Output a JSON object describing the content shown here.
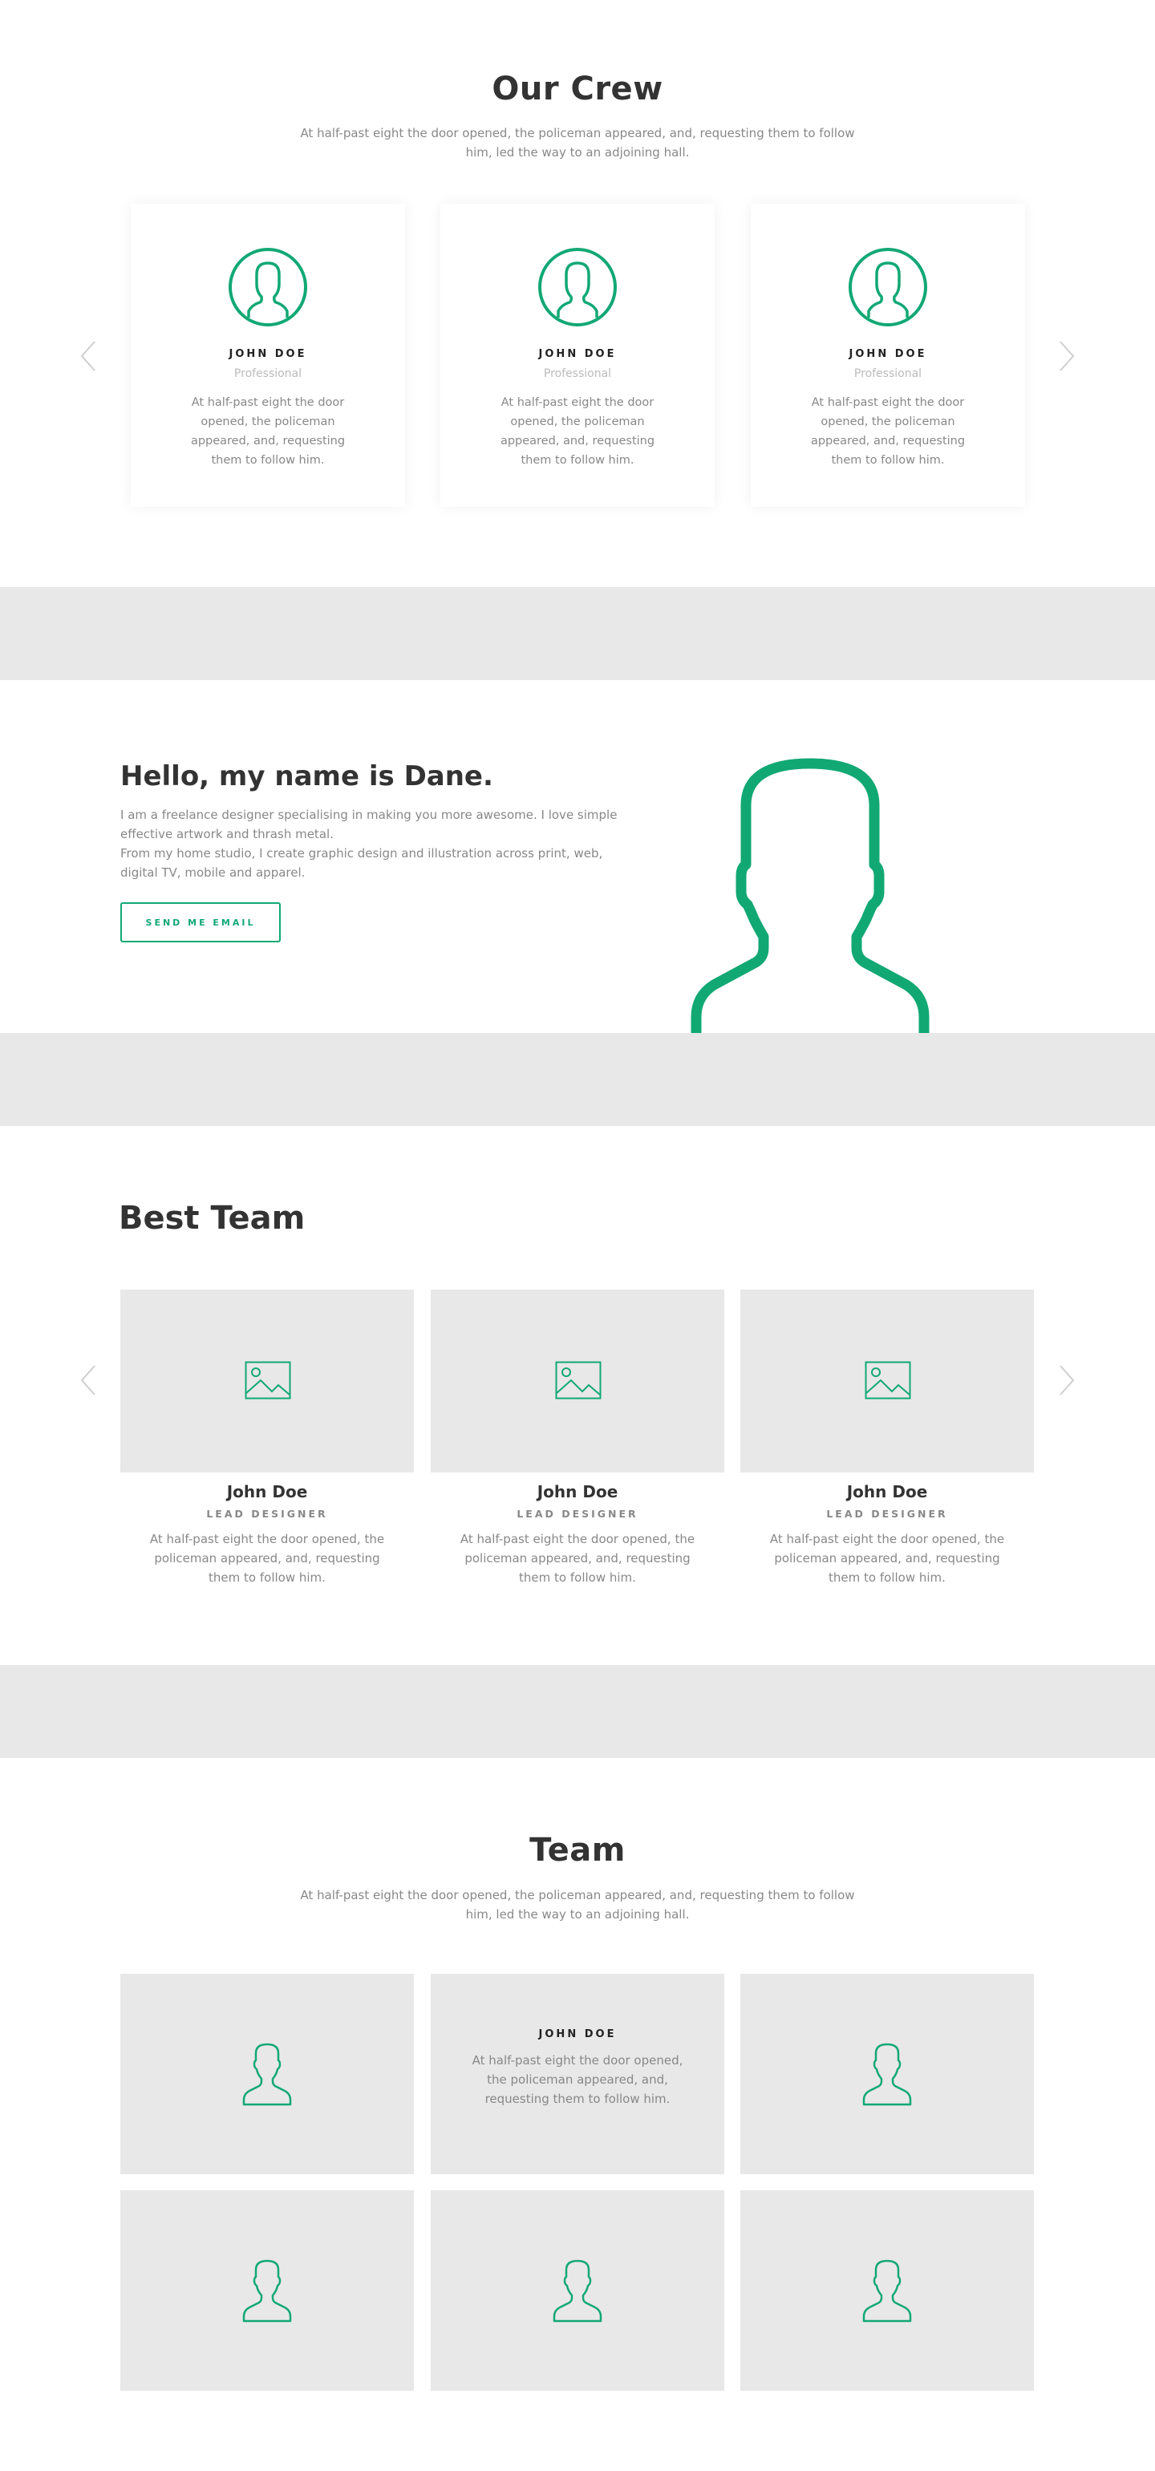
{
  "crew": {
    "title": "Our Crew",
    "description": "At half-past eight the door opened, the policeman appeared, and, requesting them to follow him, led the way to an adjoining hall.",
    "members": [
      {
        "name": "JOHN DOE",
        "role": "Professional",
        "text": "At half-past eight the door opened, the policeman appeared, and, requesting them to follow him."
      },
      {
        "name": "JOHN DOE",
        "role": "Professional",
        "text": "At half-past eight the door opened, the policeman appeared, and, requesting them to follow him."
      },
      {
        "name": "JOHN DOE",
        "role": "Professional",
        "text": "At half-past eight the door opened, the policeman appeared, and, requesting them to follow him."
      }
    ]
  },
  "hello": {
    "title": "Hello, my name is Dane.",
    "paragraph1": "I am a freelance designer specialising in making you more awesome. I love simple effective artwork and thrash metal.",
    "paragraph2": "From my home studio, I create graphic design and illustration across print, web, digital TV, mobile and apparel.",
    "button": "SEND ME EMAIL"
  },
  "best_team": {
    "title": "Best Team",
    "members": [
      {
        "name": "John Doe",
        "role": "LEAD DESIGNER",
        "text": "At half-past eight the door opened, the policeman appeared, and, requesting them to follow him."
      },
      {
        "name": "John Doe",
        "role": "LEAD DESIGNER",
        "text": "At half-past eight the door opened, the policeman appeared, and, requesting them to follow him."
      },
      {
        "name": "John Doe",
        "role": "LEAD DESIGNER",
        "text": "At half-past eight the door opened, the policeman appeared, and, requesting them to follow him."
      }
    ]
  },
  "team": {
    "title": "Team",
    "description": "At half-past eight the door opened, the policeman appeared, and, requesting them to follow him, led the way to an adjoining hall.",
    "hover_card": {
      "name": "JOHN DOE",
      "text": "At half-past eight the door opened, the policeman appeared, and, requesting them to follow him."
    }
  },
  "icons": {
    "avatar": "user-circle-icon",
    "prev": "chevron-left-icon",
    "next": "chevron-right-icon",
    "image": "image-placeholder-icon",
    "person": "person-outline-icon"
  },
  "colors": {
    "accent": "#12a874",
    "band": "#e8e8e8",
    "heading": "#333333",
    "body_text": "#888888"
  }
}
